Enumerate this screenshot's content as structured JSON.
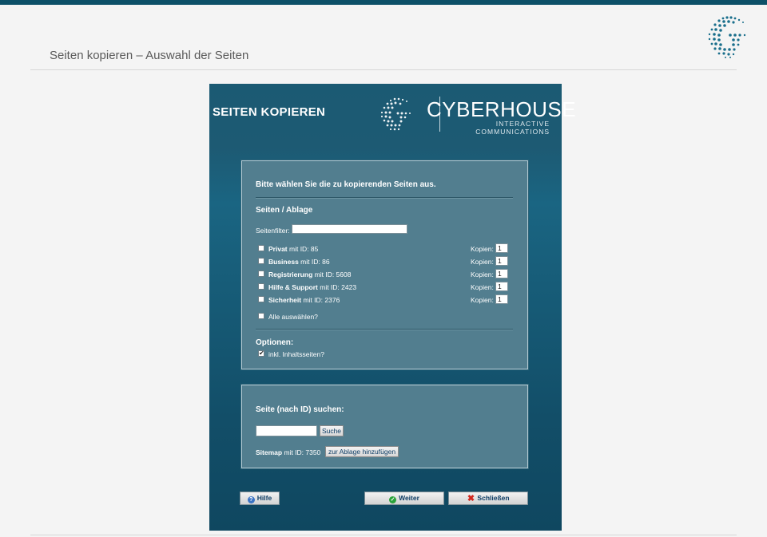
{
  "page": {
    "title": "Seiten kopieren – Auswahl der Seiten"
  },
  "dialog": {
    "title": "SEITEN KOPIEREN",
    "brand": {
      "name": "CYBERHOUSE",
      "tagline": "INTERACTIVE COMMUNICATIONS"
    }
  },
  "selection": {
    "intro": "Bitte wählen Sie die zu kopierenden Seiten aus.",
    "section_title": "Seiten / Ablage",
    "filter_label": "Seitenfilter:",
    "filter_value": "",
    "kopien_label": "Kopien:",
    "pages": [
      {
        "name": "Privat",
        "suffix": "mit ID: 85",
        "copies": "1",
        "checked": false
      },
      {
        "name": "Business",
        "suffix": "mit ID: 86",
        "copies": "1",
        "checked": false
      },
      {
        "name": "Registrierung",
        "suffix": "mit ID: 5608",
        "copies": "1",
        "checked": false
      },
      {
        "name": "Hilfe & Support",
        "suffix": "mit ID: 2423",
        "copies": "1",
        "checked": false
      },
      {
        "name": "Sicherheit",
        "suffix": "mit ID: 2376",
        "copies": "1",
        "checked": false
      }
    ],
    "select_all_label": "Alle auswählen?",
    "options_title": "Optionen:",
    "option_include_label": "inkl. Inhaltsseiten?",
    "option_include_checked": true
  },
  "search": {
    "title": "Seite (nach ID) suchen:",
    "button_label": "Suche",
    "result_name": "Sitemap",
    "result_suffix": "mit ID: 7350",
    "add_button_label": "zur Ablage hinzufügen"
  },
  "footer": {
    "help_label": "Hilfe",
    "next_label": "Weiter",
    "close_label": "Schließen"
  },
  "colors": {
    "accent": "#0d5068",
    "panel": "#527e8f",
    "dialog_bg": "#1a6582"
  }
}
